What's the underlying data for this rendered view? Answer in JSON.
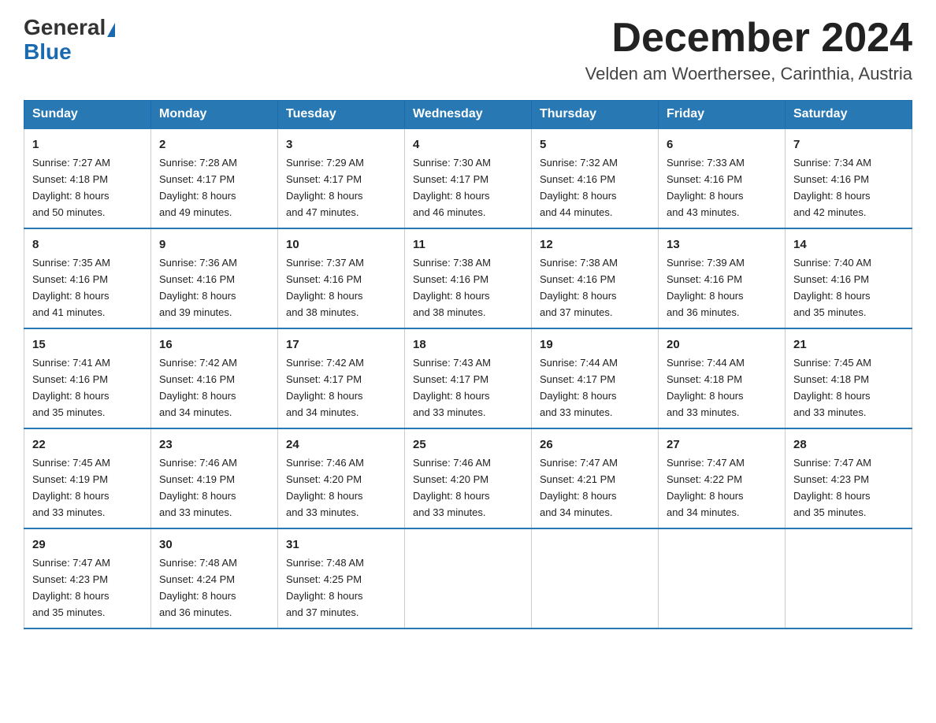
{
  "header": {
    "logo_general": "General",
    "logo_blue": "Blue",
    "month_year": "December 2024",
    "location": "Velden am Woerthersee, Carinthia, Austria"
  },
  "weekdays": [
    "Sunday",
    "Monday",
    "Tuesday",
    "Wednesday",
    "Thursday",
    "Friday",
    "Saturday"
  ],
  "weeks": [
    [
      {
        "day": "1",
        "sunrise": "7:27 AM",
        "sunset": "4:18 PM",
        "daylight": "8 hours and 50 minutes."
      },
      {
        "day": "2",
        "sunrise": "7:28 AM",
        "sunset": "4:17 PM",
        "daylight": "8 hours and 49 minutes."
      },
      {
        "day": "3",
        "sunrise": "7:29 AM",
        "sunset": "4:17 PM",
        "daylight": "8 hours and 47 minutes."
      },
      {
        "day": "4",
        "sunrise": "7:30 AM",
        "sunset": "4:17 PM",
        "daylight": "8 hours and 46 minutes."
      },
      {
        "day": "5",
        "sunrise": "7:32 AM",
        "sunset": "4:16 PM",
        "daylight": "8 hours and 44 minutes."
      },
      {
        "day": "6",
        "sunrise": "7:33 AM",
        "sunset": "4:16 PM",
        "daylight": "8 hours and 43 minutes."
      },
      {
        "day": "7",
        "sunrise": "7:34 AM",
        "sunset": "4:16 PM",
        "daylight": "8 hours and 42 minutes."
      }
    ],
    [
      {
        "day": "8",
        "sunrise": "7:35 AM",
        "sunset": "4:16 PM",
        "daylight": "8 hours and 41 minutes."
      },
      {
        "day": "9",
        "sunrise": "7:36 AM",
        "sunset": "4:16 PM",
        "daylight": "8 hours and 39 minutes."
      },
      {
        "day": "10",
        "sunrise": "7:37 AM",
        "sunset": "4:16 PM",
        "daylight": "8 hours and 38 minutes."
      },
      {
        "day": "11",
        "sunrise": "7:38 AM",
        "sunset": "4:16 PM",
        "daylight": "8 hours and 38 minutes."
      },
      {
        "day": "12",
        "sunrise": "7:38 AM",
        "sunset": "4:16 PM",
        "daylight": "8 hours and 37 minutes."
      },
      {
        "day": "13",
        "sunrise": "7:39 AM",
        "sunset": "4:16 PM",
        "daylight": "8 hours and 36 minutes."
      },
      {
        "day": "14",
        "sunrise": "7:40 AM",
        "sunset": "4:16 PM",
        "daylight": "8 hours and 35 minutes."
      }
    ],
    [
      {
        "day": "15",
        "sunrise": "7:41 AM",
        "sunset": "4:16 PM",
        "daylight": "8 hours and 35 minutes."
      },
      {
        "day": "16",
        "sunrise": "7:42 AM",
        "sunset": "4:16 PM",
        "daylight": "8 hours and 34 minutes."
      },
      {
        "day": "17",
        "sunrise": "7:42 AM",
        "sunset": "4:17 PM",
        "daylight": "8 hours and 34 minutes."
      },
      {
        "day": "18",
        "sunrise": "7:43 AM",
        "sunset": "4:17 PM",
        "daylight": "8 hours and 33 minutes."
      },
      {
        "day": "19",
        "sunrise": "7:44 AM",
        "sunset": "4:17 PM",
        "daylight": "8 hours and 33 minutes."
      },
      {
        "day": "20",
        "sunrise": "7:44 AM",
        "sunset": "4:18 PM",
        "daylight": "8 hours and 33 minutes."
      },
      {
        "day": "21",
        "sunrise": "7:45 AM",
        "sunset": "4:18 PM",
        "daylight": "8 hours and 33 minutes."
      }
    ],
    [
      {
        "day": "22",
        "sunrise": "7:45 AM",
        "sunset": "4:19 PM",
        "daylight": "8 hours and 33 minutes."
      },
      {
        "day": "23",
        "sunrise": "7:46 AM",
        "sunset": "4:19 PM",
        "daylight": "8 hours and 33 minutes."
      },
      {
        "day": "24",
        "sunrise": "7:46 AM",
        "sunset": "4:20 PM",
        "daylight": "8 hours and 33 minutes."
      },
      {
        "day": "25",
        "sunrise": "7:46 AM",
        "sunset": "4:20 PM",
        "daylight": "8 hours and 33 minutes."
      },
      {
        "day": "26",
        "sunrise": "7:47 AM",
        "sunset": "4:21 PM",
        "daylight": "8 hours and 34 minutes."
      },
      {
        "day": "27",
        "sunrise": "7:47 AM",
        "sunset": "4:22 PM",
        "daylight": "8 hours and 34 minutes."
      },
      {
        "day": "28",
        "sunrise": "7:47 AM",
        "sunset": "4:23 PM",
        "daylight": "8 hours and 35 minutes."
      }
    ],
    [
      {
        "day": "29",
        "sunrise": "7:47 AM",
        "sunset": "4:23 PM",
        "daylight": "8 hours and 35 minutes."
      },
      {
        "day": "30",
        "sunrise": "7:48 AM",
        "sunset": "4:24 PM",
        "daylight": "8 hours and 36 minutes."
      },
      {
        "day": "31",
        "sunrise": "7:48 AM",
        "sunset": "4:25 PM",
        "daylight": "8 hours and 37 minutes."
      },
      null,
      null,
      null,
      null
    ]
  ],
  "labels": {
    "sunrise": "Sunrise:",
    "sunset": "Sunset:",
    "daylight": "Daylight:"
  }
}
